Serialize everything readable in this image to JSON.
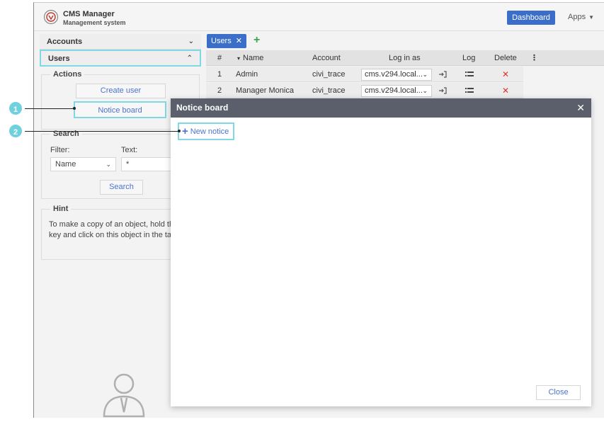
{
  "header": {
    "title": "CMS Manager",
    "subtitle": "Management system",
    "dashboard_label": "Dashboard",
    "apps_label": "Apps"
  },
  "sidebar": {
    "accounts_label": "Accounts",
    "users_label": "Users",
    "actions": {
      "legend": "Actions",
      "create_user": "Create user",
      "notice_board": "Notice board"
    },
    "search": {
      "legend": "Search",
      "filter_label": "Filter:",
      "filter_value": "Name",
      "text_label": "Text:",
      "text_value": "*",
      "button": "Search"
    },
    "hint": {
      "legend": "Hint",
      "text": "To make a copy of an object, hold the Ctrl key and click on this object in the table."
    }
  },
  "tabs": [
    {
      "label": "Users"
    }
  ],
  "grid": {
    "headers": {
      "num": "#",
      "name": "Name",
      "account": "Account",
      "login_as": "Log in as",
      "log": "Log",
      "delete": "Delete"
    },
    "rows": [
      {
        "num": "1",
        "name": "Admin",
        "account": "civi_trace",
        "login": "cms.v294.local..."
      },
      {
        "num": "2",
        "name": "Manager Monica",
        "account": "civi_trace",
        "login": "cms.v294.local..."
      }
    ]
  },
  "modal": {
    "title": "Notice board",
    "new_notice": "New notice",
    "close": "Close"
  },
  "callouts": [
    "1",
    "2"
  ],
  "colors": {
    "accent": "#3b6ec9",
    "highlight": "#7fd8e4",
    "modal_header": "#5a5f6b",
    "delete": "#e03232",
    "add": "#3fa34d"
  }
}
